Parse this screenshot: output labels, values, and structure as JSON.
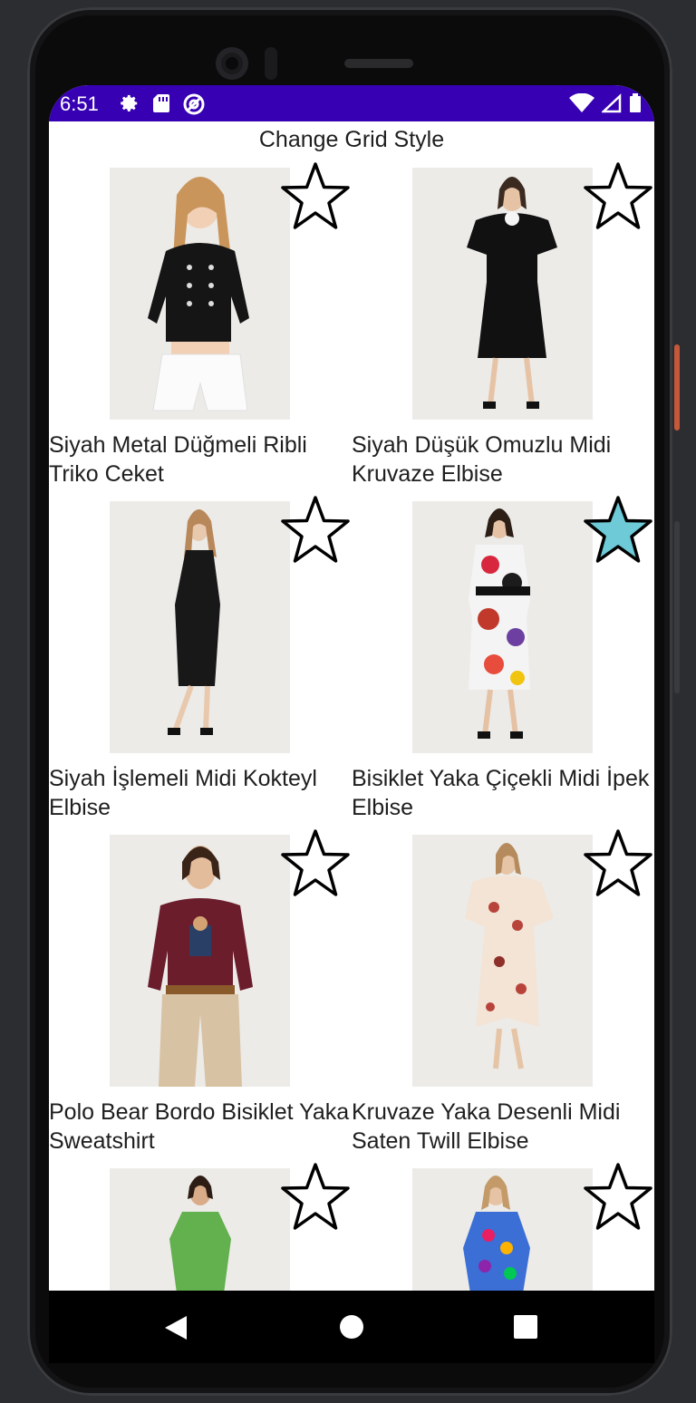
{
  "status": {
    "time": "6:51"
  },
  "header": {
    "title": "Change Grid Style"
  },
  "colors": {
    "status_bar": "#3700b3",
    "favorite_fill": "#6dcad6"
  },
  "products": [
    {
      "name": "Siyah Metal Düğmeli Ribli Triko Ceket",
      "favorite": false
    },
    {
      "name": "Siyah Düşük Omuzlu Midi Kruvaze Elbise",
      "favorite": false
    },
    {
      "name": "Siyah İşlemeli Midi Kokteyl Elbise",
      "favorite": false
    },
    {
      "name": "Bisiklet Yaka Çiçekli Midi İpek Elbise",
      "favorite": true
    },
    {
      "name": "Polo Bear Bordo Bisiklet Yaka Sweatshirt",
      "favorite": false
    },
    {
      "name": "Kruvaze Yaka Desenli Midi Saten Twill Elbise",
      "favorite": false
    },
    {
      "name": "",
      "favorite": false
    },
    {
      "name": "",
      "favorite": false
    }
  ],
  "icons": [
    "settings-icon",
    "sd-card-icon",
    "vpn-icon",
    "wifi-icon",
    "signal-icon",
    "battery-icon",
    "star-icon",
    "back-icon",
    "home-icon",
    "recents-icon"
  ]
}
